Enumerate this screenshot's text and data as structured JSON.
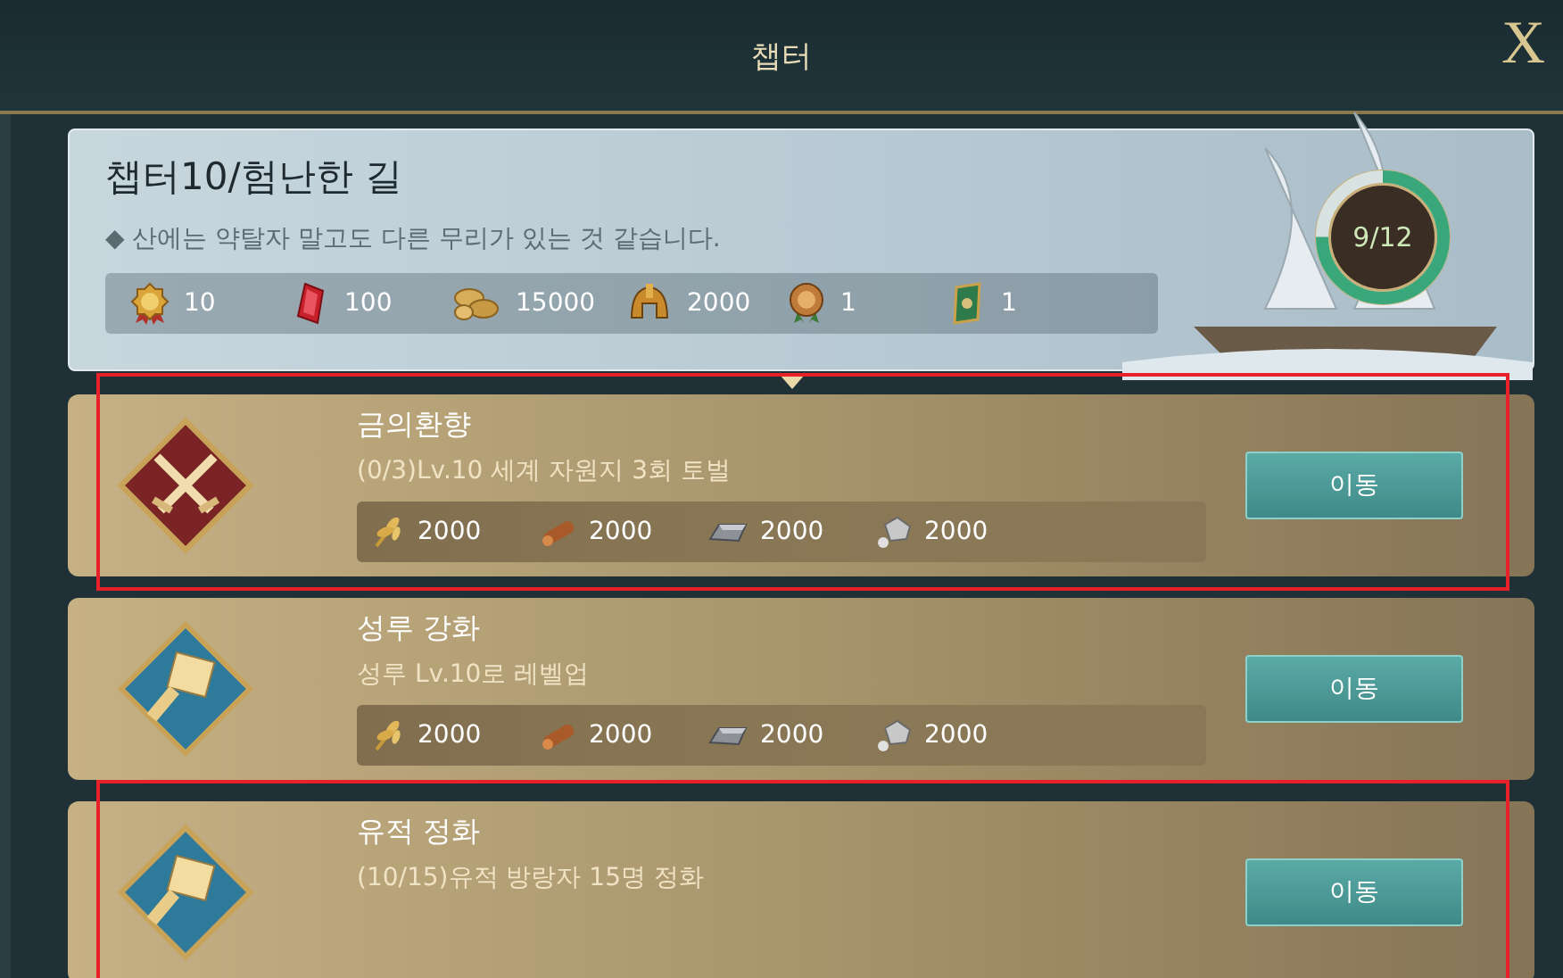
{
  "header": {
    "title": "챕터",
    "close": "X"
  },
  "chapter": {
    "title": "챕터10/험난한 길",
    "description": "◆ 산에는 약탈자 말고도 다른 무리가 있는 것 같습니다.",
    "progress": {
      "text": "9/12",
      "level": 0.75
    },
    "rewards": [
      {
        "kind": "medal",
        "amount": "10"
      },
      {
        "kind": "gem",
        "amount": "100"
      },
      {
        "kind": "coins",
        "amount": "15000"
      },
      {
        "kind": "helmet",
        "amount": "2000"
      },
      {
        "kind": "badge",
        "amount": "1"
      },
      {
        "kind": "scroll",
        "amount": "1"
      }
    ]
  },
  "quests": [
    {
      "kind": "swords",
      "title": "금의환향",
      "subtitle": "(0/3)Lv.10 세계 자원지 3회 토벌",
      "button": "이동",
      "highlighted": true,
      "rewards": [
        {
          "kind": "wheat",
          "amount": "2000"
        },
        {
          "kind": "wood",
          "amount": "2000"
        },
        {
          "kind": "iron",
          "amount": "2000"
        },
        {
          "kind": "stone",
          "amount": "2000"
        }
      ]
    },
    {
      "kind": "hammer",
      "title": "성루 강화",
      "subtitle": "성루 Lv.10로 레벨업",
      "button": "이동",
      "highlighted": false,
      "rewards": [
        {
          "kind": "wheat",
          "amount": "2000"
        },
        {
          "kind": "wood",
          "amount": "2000"
        },
        {
          "kind": "iron",
          "amount": "2000"
        },
        {
          "kind": "stone",
          "amount": "2000"
        }
      ]
    },
    {
      "kind": "hammer",
      "title": "유적 정화",
      "subtitle": "(10/15)유적 방랑자 15명 정화",
      "button": "이동",
      "highlighted": true
    }
  ]
}
